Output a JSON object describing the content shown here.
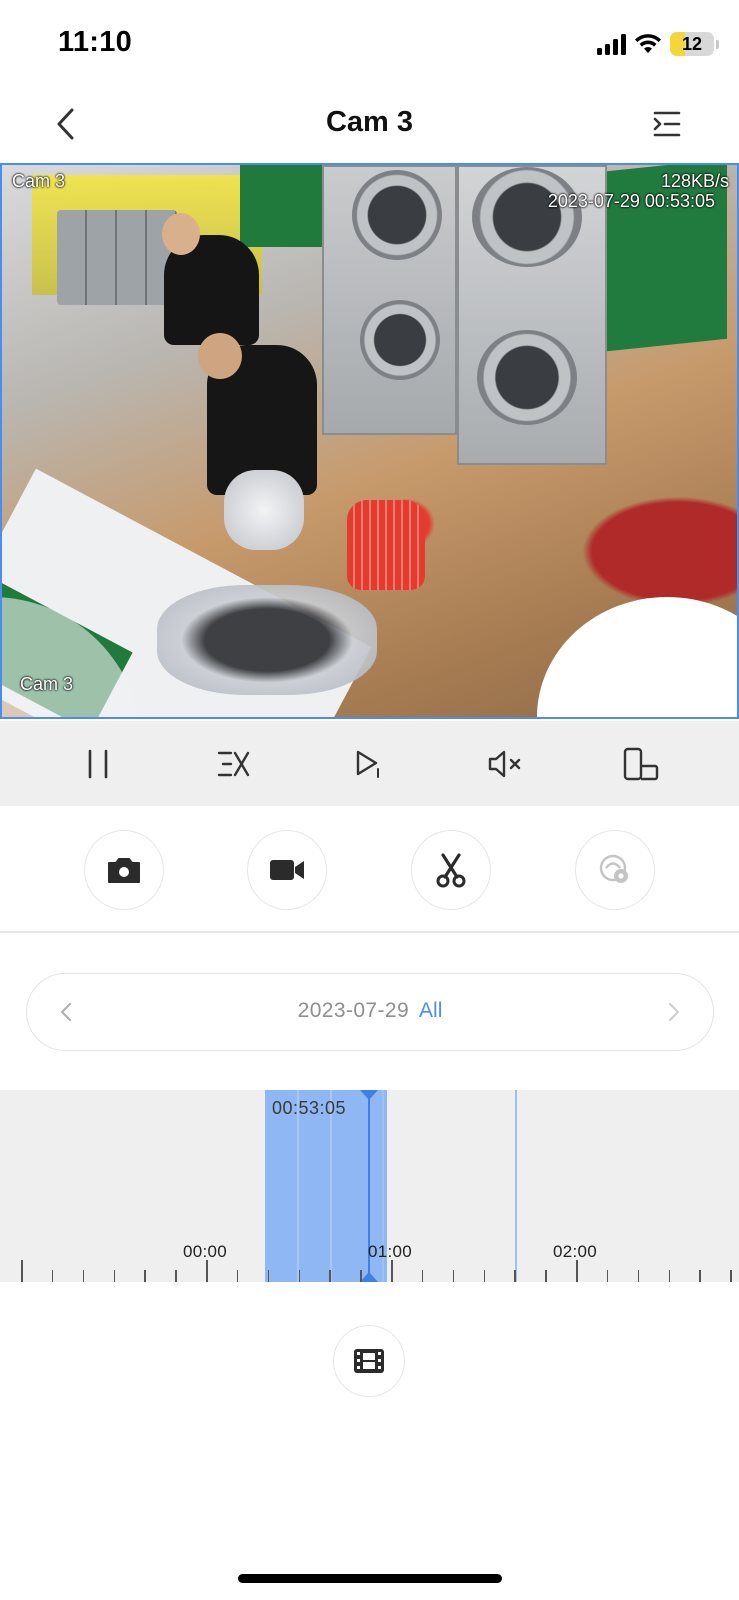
{
  "status_bar": {
    "time": "11:10",
    "battery": "12"
  },
  "nav": {
    "title": "Cam 3",
    "back_icon": "chevron-left-icon",
    "menu_icon": "list-indent-icon"
  },
  "video": {
    "osd_camera_top": "Cam 3",
    "osd_bitrate": "128KB/s",
    "osd_timestamp": "2023-07-29 00:53:05",
    "osd_camera_bottom": "Cam 3"
  },
  "controls": [
    {
      "name": "pause-button",
      "icon": "pause-icon"
    },
    {
      "name": "playback-speed-button",
      "icon": "speed-icon"
    },
    {
      "name": "play-step-button",
      "icon": "play-step-icon"
    },
    {
      "name": "mute-button",
      "icon": "speaker-muted-icon"
    },
    {
      "name": "rotate-fullscreen-button",
      "icon": "rotate-screen-icon"
    }
  ],
  "actions": [
    {
      "name": "snapshot-button",
      "icon": "camera-icon"
    },
    {
      "name": "record-button",
      "icon": "video-camera-icon"
    },
    {
      "name": "clip-button",
      "icon": "scissors-icon"
    },
    {
      "name": "smart-search-button",
      "icon": "face-search-icon"
    }
  ],
  "date_selector": {
    "date": "2023-07-29",
    "filter": "All"
  },
  "timeline": {
    "current_time": "00:53:05",
    "labels": [
      "00:00",
      "01:00",
      "02:00"
    ],
    "recording_range": {
      "start": "00:20",
      "end": "00:59"
    },
    "cursor_time": "00:53:05"
  },
  "library_button": {
    "icon": "film-icon"
  },
  "colors": {
    "accent": "#4e8fe8",
    "timeline_record": "#8fb7f3",
    "cursor": "#3f7fe6"
  }
}
